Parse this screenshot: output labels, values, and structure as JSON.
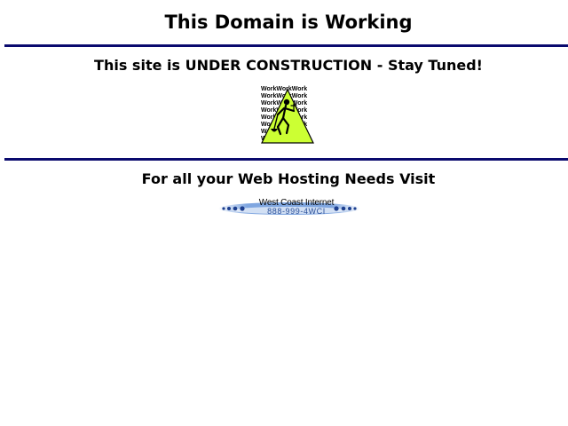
{
  "page": {
    "title": "This Domain is Working",
    "status_message": "This site is UNDER CONSTRUCTION - Stay Tuned!",
    "hosting_prompt": "For all your Web Hosting Needs Visit"
  },
  "construction_sign": {
    "icon": "construction-worker-icon",
    "word": "Work",
    "fill_color": "#ccff33"
  },
  "host_banner": {
    "company": "West Coast Internet",
    "phone": "888-999-4WCI",
    "color": "#2a4f9a"
  },
  "colors": {
    "rule": "#0a0a6e"
  }
}
